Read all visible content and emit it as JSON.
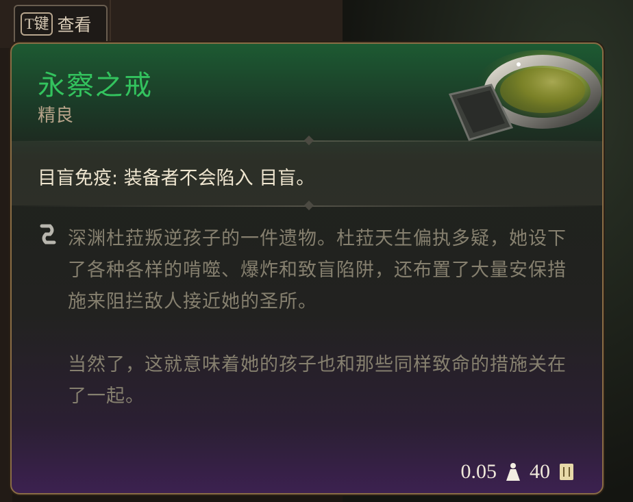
{
  "hint": {
    "key": "T键",
    "action": "查看"
  },
  "item": {
    "name": "永察之戒",
    "rarity": "精良",
    "passive": "目盲免疫: 装备者不会陷入 目盲。",
    "lore": [
      "深渊杜菈叛逆孩子的一件遗物。杜菈天生偏执多疑，她设下了各种各样的啃噬、爆炸和致盲陷阱，还布置了大量安保措施来阻拦敌人接近她的圣所。",
      "当然了，这就意味着她的孩子也和那些同样致命的措施关在了一起。"
    ],
    "weight": "0.05",
    "value": "40"
  },
  "colors": {
    "name": "#33c35e",
    "rarity": "#b7a48a",
    "border": "#8a6d45"
  },
  "icons": {
    "lore": "scroll-icon",
    "weight": "weight-icon",
    "value": "gold-icon",
    "item": "ring-image"
  }
}
